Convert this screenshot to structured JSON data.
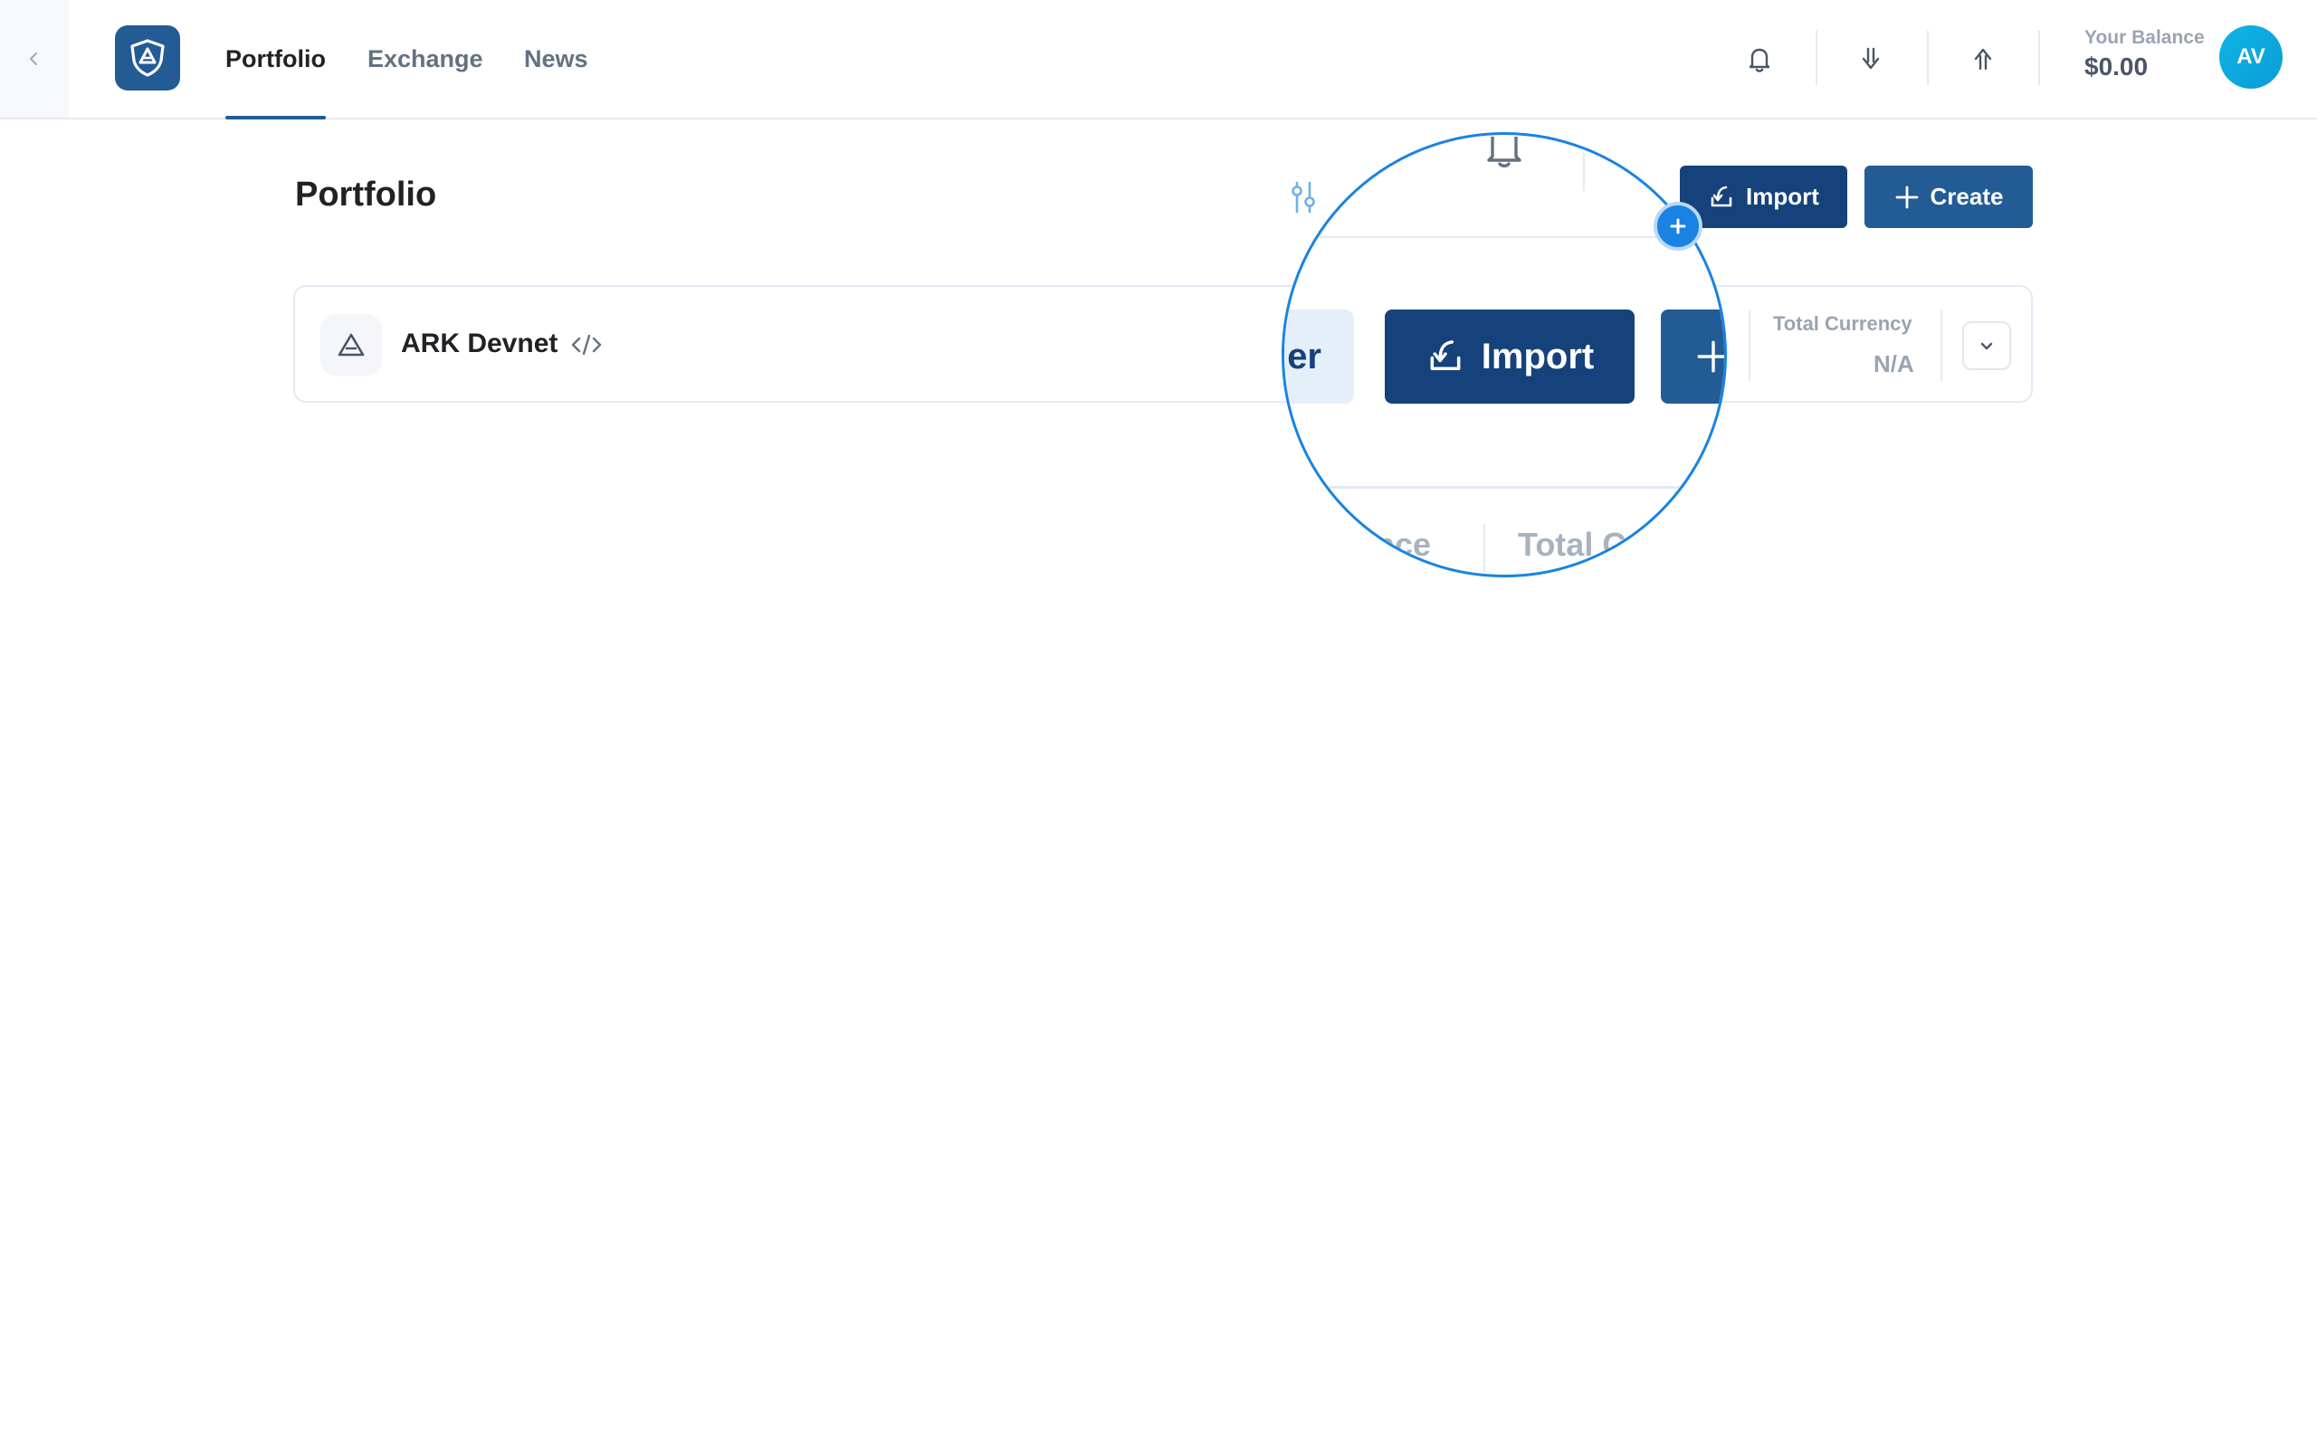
{
  "nav": {
    "tabs": [
      {
        "label": "Portfolio",
        "active": true
      },
      {
        "label": "Exchange",
        "active": false
      },
      {
        "label": "News",
        "active": false
      }
    ],
    "icons": [
      "bell-icon",
      "receive-icon",
      "send-icon"
    ],
    "balance_label": "Your Balance",
    "balance_value": "$0.00",
    "avatar_initials": "AV"
  },
  "page": {
    "title": "Portfolio",
    "import_label": "Import",
    "create_label": "Create"
  },
  "wallet_group": {
    "network_name": "ARK Devnet",
    "total_currency_label": "Total Currency",
    "total_currency_value": "N/A"
  },
  "magnifier": {
    "partial_label": "er",
    "import_label": "Import",
    "balance_fragment": "ance",
    "total_fragment": "Total Cu"
  },
  "colors": {
    "primary": "#235b95",
    "primary_dark": "#15427a",
    "accent": "#1a82e2",
    "avatar": "#0fb5e6"
  }
}
